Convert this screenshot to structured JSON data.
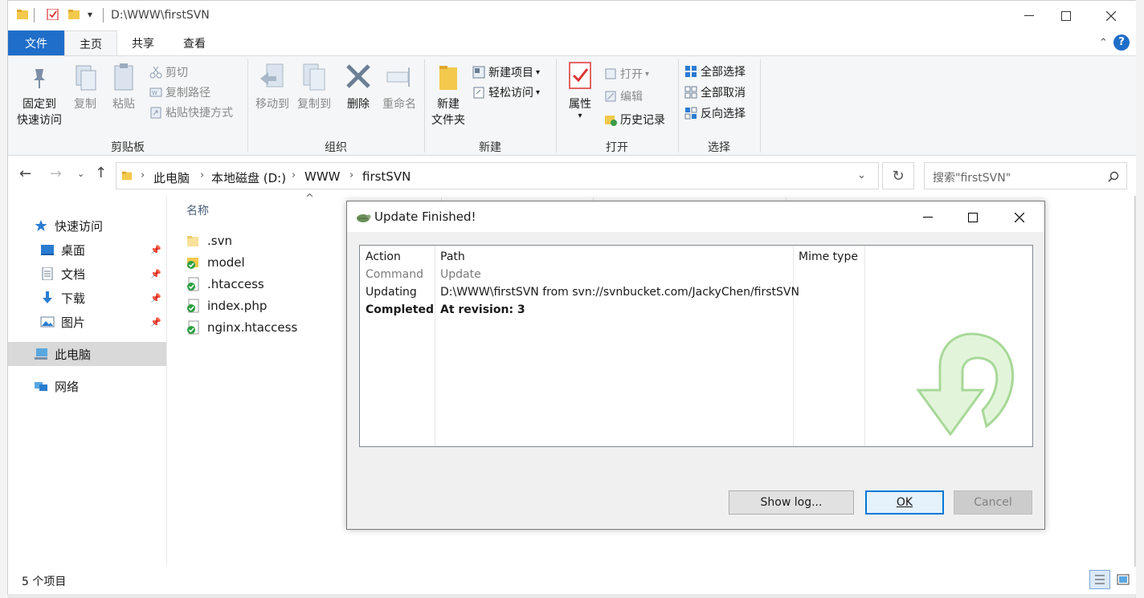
{
  "window": {
    "title": "D:\\WWW\\firstSVN"
  },
  "menu": {
    "file": "文件",
    "home": "主页",
    "share": "共享",
    "view": "查看"
  },
  "ribbon": {
    "clipboard": {
      "label": "剪贴板",
      "pin_line1": "固定到",
      "pin_line2": "快速访问",
      "copy": "复制",
      "paste": "粘贴",
      "cut": "剪切",
      "copy_path": "复制路径",
      "paste_shortcut": "粘贴快捷方式"
    },
    "organize": {
      "label": "组织",
      "move_to": "移动到",
      "copy_to": "复制到",
      "delete": "删除",
      "rename": "重命名"
    },
    "new": {
      "label": "新建",
      "new_folder_line1": "新建",
      "new_folder_line2": "文件夹",
      "new_item": "新建项目",
      "easy_access": "轻松访问"
    },
    "open": {
      "label": "打开",
      "properties": "属性",
      "open": "打开",
      "edit": "编辑",
      "history": "历史记录"
    },
    "select": {
      "label": "选择",
      "select_all": "全部选择",
      "select_none": "全部取消",
      "invert": "反向选择"
    }
  },
  "address": {
    "crumbs": [
      "此电脑",
      "本地磁盘 (D:)",
      "WWW",
      "firstSVN"
    ],
    "search_placeholder": "搜索\"firstSVN\""
  },
  "nav": {
    "quick_access": "快速访问",
    "desktop": "桌面",
    "documents": "文档",
    "downloads": "下载",
    "pictures": "图片",
    "this_pc": "此电脑",
    "network": "网络"
  },
  "files": {
    "header_name": "名称",
    "items": [
      ".svn",
      "model",
      ".htaccess",
      "index.php",
      "nginx.htaccess"
    ]
  },
  "status": {
    "count": "5 个项目"
  },
  "dialog": {
    "title": "Update Finished!",
    "columns": {
      "action": "Action",
      "path": "Path",
      "mime": "Mime type"
    },
    "rows": [
      {
        "action": "Command",
        "path": "Update"
      },
      {
        "action": "Updating",
        "path": "D:\\WWW\\firstSVN from svn://svnbucket.com/JackyChen/firstSVN"
      },
      {
        "action": "Completed",
        "path": "At revision: 3"
      }
    ],
    "show_log": "Show log...",
    "ok": "OK",
    "cancel": "Cancel"
  },
  "colors": {
    "accent": "#1f6ec9",
    "svn_green": "#2ea043",
    "folder": "#f2c94c"
  }
}
